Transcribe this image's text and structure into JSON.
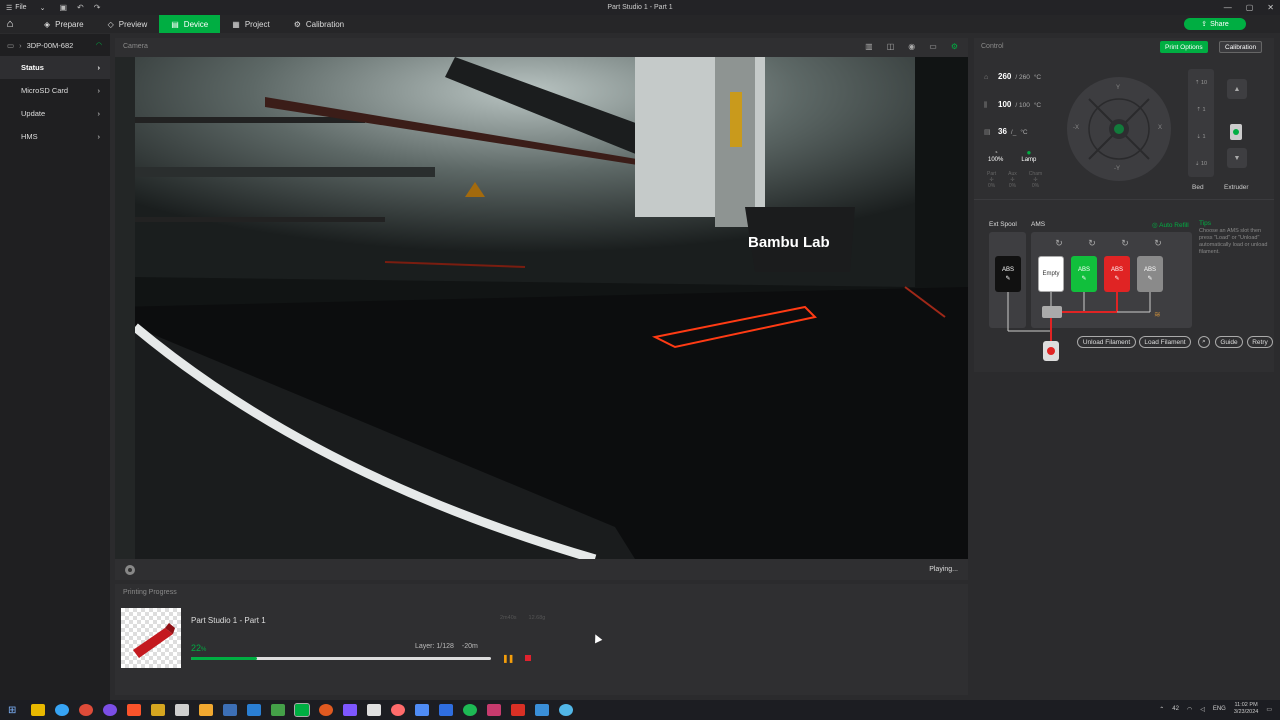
{
  "titlebar": {
    "menu_icon": "hamburger-icon",
    "file_label": "File",
    "title": "Part Studio 1 - Part 1"
  },
  "tabs": [
    {
      "label": "Prepare",
      "icon": "cube-icon"
    },
    {
      "label": "Preview",
      "icon": "layers-icon"
    },
    {
      "label": "Device",
      "icon": "printer-icon",
      "active": true
    },
    {
      "label": "Project",
      "icon": "project-icon"
    },
    {
      "label": "Calibration",
      "icon": "calibration-icon"
    }
  ],
  "share_label": "Share",
  "sidebar": {
    "printer_name": "3DP-00M-682",
    "items": [
      {
        "label": "Status",
        "active": true
      },
      {
        "label": "MicroSD Card"
      },
      {
        "label": "Update"
      },
      {
        "label": "HMS"
      }
    ]
  },
  "camera": {
    "title": "Camera",
    "status": "Playing...",
    "overlay_brand": "Bambu Lab"
  },
  "progress": {
    "title": "Printing Progress",
    "job_name": "Part Studio 1 - Part 1",
    "time_meta": "2m40s",
    "weight_meta": "12.68g",
    "percent": 22,
    "percent_sign": "%",
    "layer": "Layer: 1/128",
    "remaining": "-20m"
  },
  "control": {
    "title": "Control",
    "print_options": "Print Options",
    "calibration": "Calibration",
    "nozzle": {
      "current": "260",
      "target": "/ 260",
      "unit": "°C"
    },
    "bed": {
      "current": "100",
      "target": "/ 100",
      "unit": "°C"
    },
    "chamber": {
      "current": "36",
      "target": "/_",
      "unit": "°C"
    },
    "fan_speed": "100%",
    "lamp_label": "Lamp",
    "fans": [
      {
        "name": "Part",
        "value": "0%"
      },
      {
        "name": "Aux",
        "value": "0%"
      },
      {
        "name": "Cham",
        "value": "0%"
      }
    ],
    "axes": {
      "y": "Y",
      "neg_y": "-Y",
      "x": "X",
      "neg_x": "-X"
    },
    "bed_steps": [
      "10",
      "1",
      "1",
      "10"
    ],
    "bed_label": "Bed",
    "extruder_label": "Extruder"
  },
  "ams": {
    "ext_spool_label": "Ext Spool",
    "ams_label": "AMS",
    "auto_refill": "Auto Refill",
    "ext_spool": {
      "material": "ABS",
      "color": "#111111"
    },
    "slots": [
      {
        "material": "Empty",
        "color": "#ffffff",
        "text_color": "#333333"
      },
      {
        "material": "ABS",
        "color": "#11bf3c",
        "text_color": "#ffffff"
      },
      {
        "material": "ABS",
        "color": "#e02424",
        "text_color": "#ffffff"
      },
      {
        "material": "ABS",
        "color": "#8a8a8a",
        "text_color": "#ffffff"
      }
    ],
    "tips_title": "Tips",
    "tips_text": "Choose an AMS slot then press \"Load\" or \"Unload\" automatically load or unload filament.",
    "unload_label": "Unload Filament",
    "load_label": "Load Filament",
    "guide_label": "Guide",
    "retry_label": "Retry"
  },
  "taskbar": {
    "lang": "ENG",
    "time": "11:02 PM",
    "date": "3/23/2024",
    "temp": "42"
  }
}
